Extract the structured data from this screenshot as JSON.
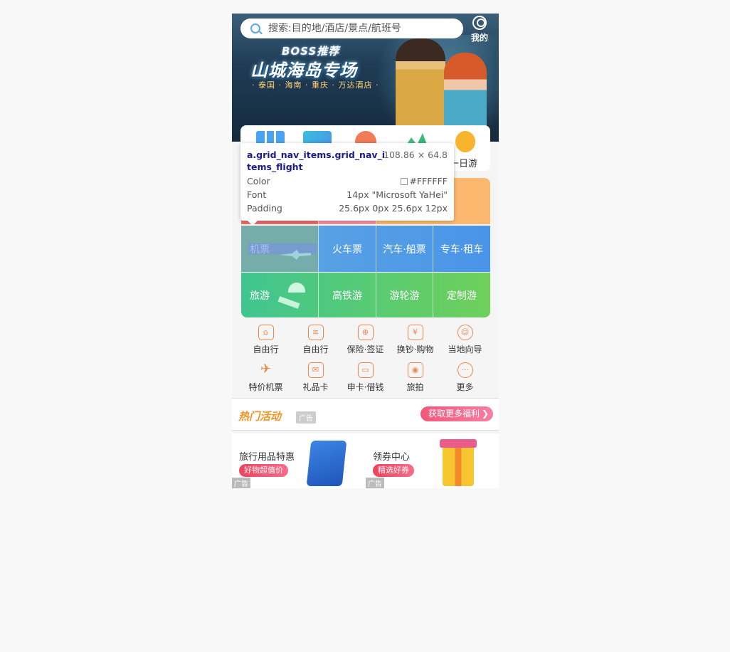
{
  "search": {
    "placeholder": "搜索:目的地/酒店/景点/航班号"
  },
  "header": {
    "mine_label": "我的"
  },
  "banner": {
    "line1": "BOSS推荐",
    "line2": "山城海岛专场",
    "line3": "· 泰国 · 海南 · 重庆 · 万达酒店 ·"
  },
  "top_nav": {
    "visible_label": "一日游"
  },
  "inspector": {
    "selector": "a.grid_nav_items.grid_nav_items_flight",
    "size": "108.86 × 64.8",
    "color_label": "Color",
    "color_value": "#FFFFFF",
    "font_label": "Font",
    "font_value": "14px \"Microsoft YaHei\"",
    "padding_label": "Padding",
    "padding_value": "25.6px 0px 25.6px 12px"
  },
  "grid": {
    "row2": [
      "机票",
      "火车票",
      "汽车·船票",
      "专车·租车"
    ],
    "row3": [
      "旅游",
      "高铁游",
      "游轮游",
      "定制游"
    ]
  },
  "icons": {
    "row1": [
      {
        "label": "自由行",
        "icon": "backpack-icon"
      },
      {
        "label": "自由行",
        "icon": "wifi-card-icon"
      },
      {
        "label": "保险·签证",
        "icon": "shield-icon"
      },
      {
        "label": "换钞·购物",
        "icon": "shopping-bag-icon"
      },
      {
        "label": "当地向导",
        "icon": "guide-hat-icon"
      }
    ],
    "row2": [
      {
        "label": "特价机票",
        "icon": "plane-icon"
      },
      {
        "label": "礼品卡",
        "icon": "gift-card-icon"
      },
      {
        "label": "申卡·借钱",
        "icon": "credit-card-icon"
      },
      {
        "label": "旅拍",
        "icon": "camera-icon"
      },
      {
        "label": "更多",
        "icon": "more-icon"
      }
    ]
  },
  "hot": {
    "title": "热门活动",
    "ad_tag": "广告",
    "more_button": "获取更多福利"
  },
  "promos": [
    {
      "title": "旅行用品特惠",
      "tag": "好物超值价",
      "ad": "广告"
    },
    {
      "title": "领券中心",
      "tag": "精选好券",
      "ad": "广告"
    }
  ]
}
